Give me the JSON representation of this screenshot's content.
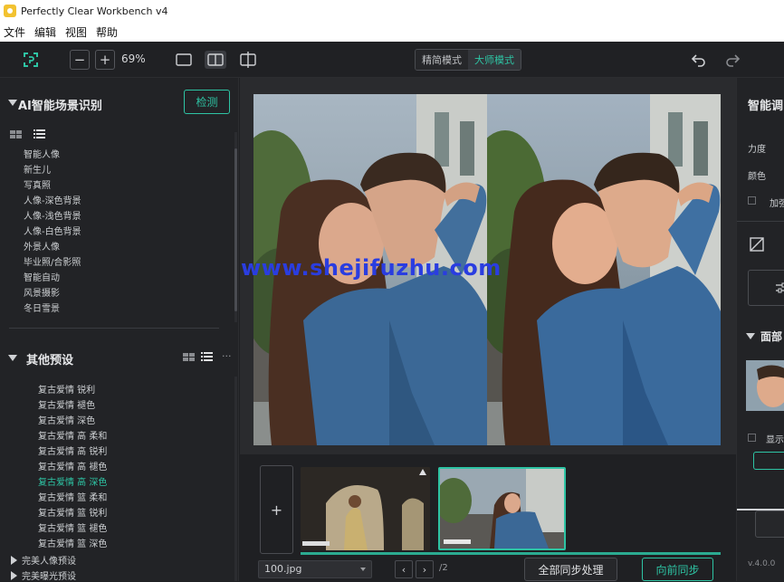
{
  "window": {
    "title": "Perfectly Clear Workbench v4"
  },
  "menu": [
    "文件",
    "编辑",
    "视图",
    "帮助"
  ],
  "toolbar": {
    "zoom": "69%",
    "zoom_out": "−",
    "zoom_in": "+",
    "mode_simple": "精简模式",
    "mode_master": "大师模式"
  },
  "ai_section": {
    "title": "AI智能场景识别",
    "detect_button": "检测",
    "items": [
      "智能人像",
      "新生儿",
      "写真照",
      "人像-深色背景",
      "人像-浅色背景",
      "人像-白色背景",
      "外景人像",
      "毕业照/合影照",
      "智能自动",
      "风景摄影",
      "冬日雪景"
    ]
  },
  "other_section": {
    "title": "其他预设",
    "more": "···",
    "items": [
      "复古爱情 锐利",
      "复古爱情 褪色",
      "复古爱情 深色",
      "复古爱情 高 柔和",
      "复古爱情 高 锐利",
      "复古爱情 高 褪色",
      "复古爱情 高 深色",
      "复古爱情 篮 柔和",
      "复古爱情 篮 锐利",
      "复古爱情 篮 褪色",
      "复古爱情 篮 深色"
    ],
    "active_index": 6,
    "groups": [
      "完美人像预设",
      "完美曝光预设"
    ]
  },
  "canvas": {
    "watermark": "www.shejifuzhu.com"
  },
  "filmstrip": {
    "add": "+"
  },
  "status": {
    "file": "100.jpg",
    "prev": "‹",
    "next": "›",
    "count": "/2",
    "sync_all": "全部同步处理",
    "sync_forward": "向前同步"
  },
  "right_panel": {
    "title": "智能调",
    "strength": "力度",
    "color": "颜色",
    "add": "加强",
    "face_section": "面部",
    "show": "显示",
    "version": "v.4.0.0"
  },
  "colors": {
    "accent": "#2ec4a4",
    "bg": "#1f2023",
    "panel": "#222326",
    "watermark": "#2a3de0"
  }
}
